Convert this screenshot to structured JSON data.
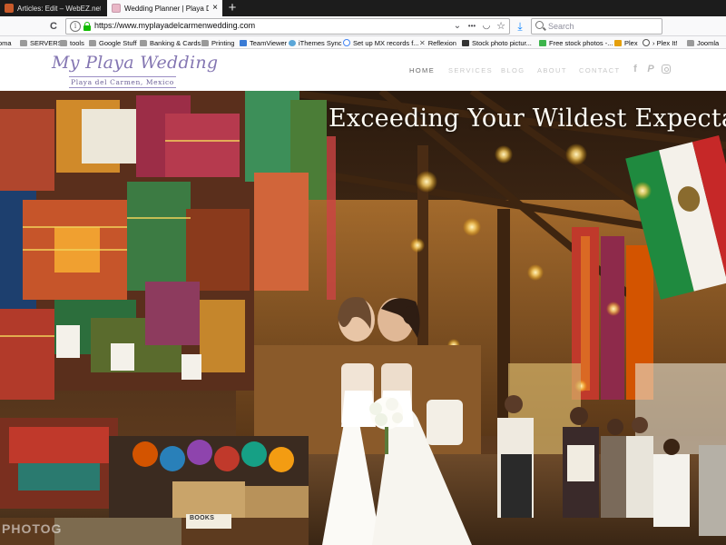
{
  "browser": {
    "tabs": [
      {
        "title": "Articles: Edit – WebEZ.net Adv",
        "close": "×"
      },
      {
        "title": "Wedding Planner | Playa Del Ca",
        "close": "×"
      }
    ],
    "new_tab": "+",
    "toolbar": {
      "reload": "C",
      "url": "https://www.myplayadelcarmenwedding.com",
      "page_actions": "•••",
      "pocket": "◡",
      "bookmark_star": "☆",
      "dropdown": "⌄",
      "download": "⤓",
      "search_placeholder": "Search"
    },
    "bookmarks": [
      {
        "label": "oma",
        "icon": "folder"
      },
      {
        "label": "SERVERS",
        "icon": "folder"
      },
      {
        "label": "tools",
        "icon": "folder"
      },
      {
        "label": "Google Stuff",
        "icon": "folder"
      },
      {
        "label": "Banking & Cards",
        "icon": "folder"
      },
      {
        "label": "Printing",
        "icon": "folder"
      },
      {
        "label": "TeamViewer",
        "icon": "teamviewer"
      },
      {
        "label": "iThemes Sync",
        "icon": "ithemes"
      },
      {
        "label": "Set up MX records f...",
        "icon": "google"
      },
      {
        "label": "Reflexion",
        "icon": "reflexion"
      },
      {
        "label": "Stock photo pictur...",
        "icon": "camera"
      },
      {
        "label": "Free stock photos -...",
        "icon": "freestock"
      },
      {
        "label": "Plex",
        "icon": "plex"
      },
      {
        "label": "› Plex It!",
        "icon": "globe"
      },
      {
        "label": "Joomla",
        "icon": "folder"
      }
    ]
  },
  "site": {
    "logo": {
      "script": "My Playa Wedding",
      "subtitle": "Playa del Carmen, Mexico"
    },
    "nav": [
      {
        "label": "HOME",
        "active": true
      },
      {
        "label": "SERVICES",
        "active": false
      },
      {
        "label": "BLOG",
        "active": false
      },
      {
        "label": "ABOUT",
        "active": false
      },
      {
        "label": "CONTACT",
        "active": false
      }
    ],
    "social": {
      "facebook": "f",
      "pinterest": "P",
      "instagram": ""
    },
    "hero": {
      "headline": "Exceeding Your Wildest Expectat",
      "sign_books": "BOOKS",
      "watermark": "PHOTOG"
    }
  },
  "colors": {
    "logo_purple": "#8476b2",
    "nav_active": "#666666",
    "nav_inactive": "#c8c8c8",
    "tab_bar": "#1c1c1c",
    "secure_lock": "#12bc00"
  }
}
